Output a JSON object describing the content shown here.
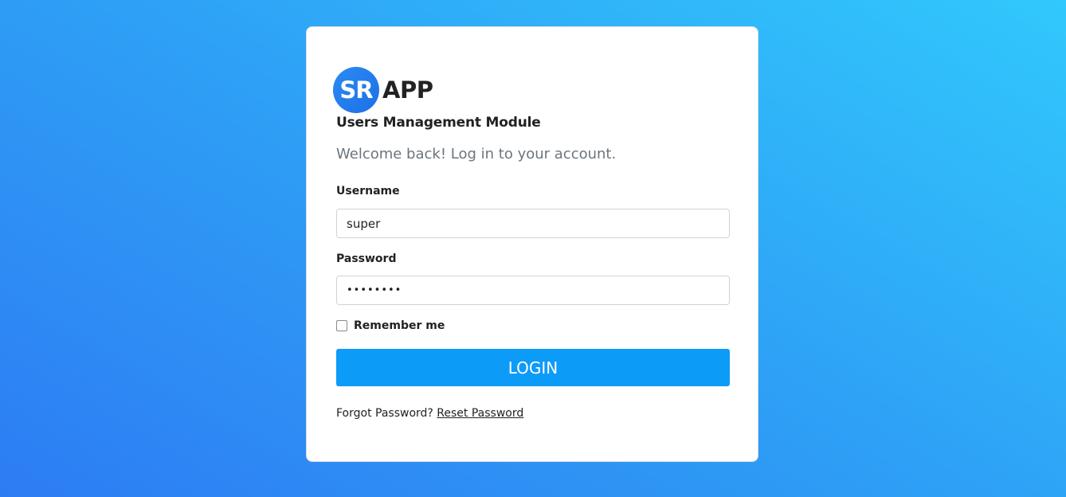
{
  "brand": {
    "logo_initials": "SR",
    "logo_text": "APP"
  },
  "module_title": "Users Management Module",
  "welcome_text": "Welcome back! Log in to your account.",
  "form": {
    "username_label": "Username",
    "username_value": "super",
    "password_label": "Password",
    "password_value": "••••••••",
    "remember_label": "Remember me",
    "remember_checked": false,
    "login_label": "LOGIN"
  },
  "footer": {
    "forgot_text": "Forgot Password?",
    "reset_link": "Reset Password"
  },
  "colors": {
    "button": "#0d9bf8",
    "logo": "#1e6fe8",
    "background_start": "#2d7cf3",
    "background_end": "#31c8fc"
  }
}
